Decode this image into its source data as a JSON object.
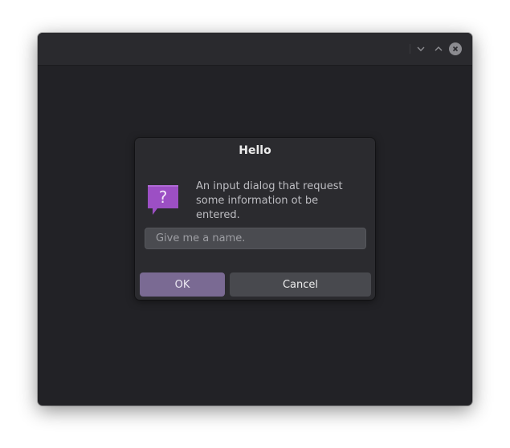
{
  "window": {
    "controls": {
      "minimize_icon": "chevron-down-icon",
      "maximize_icon": "chevron-up-icon",
      "close_icon": "close-icon"
    }
  },
  "dialog": {
    "title": "Hello",
    "icon": "question-bubble-icon",
    "message": "An input dialog that request some information ot be entered.",
    "input": {
      "value": "",
      "placeholder": "Give me a name."
    },
    "buttons": {
      "ok_label": "OK",
      "cancel_label": "Cancel"
    }
  },
  "colors": {
    "accent": "#7a6a93",
    "icon_purple": "#9c4fc4"
  }
}
